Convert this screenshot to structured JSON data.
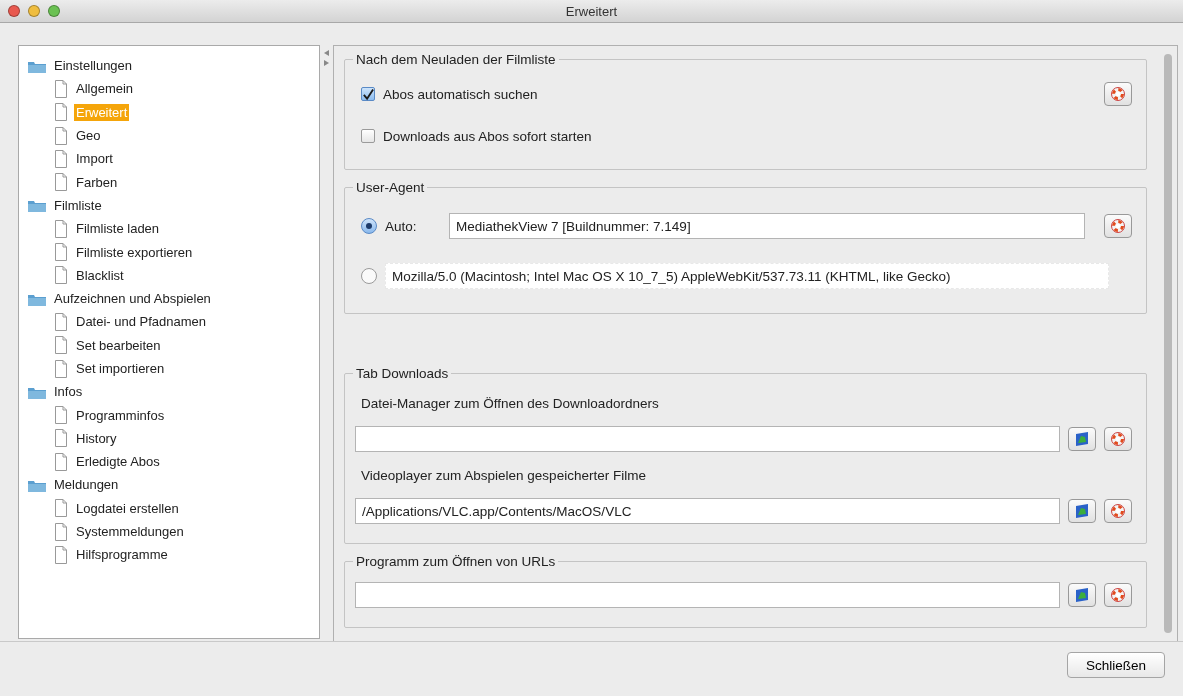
{
  "window": {
    "title": "Erweitert"
  },
  "tree": [
    {
      "label": "Einstellungen",
      "selected": false,
      "children": [
        {
          "label": "Allgemein",
          "selected": false
        },
        {
          "label": "Erweitert",
          "selected": true
        },
        {
          "label": "Geo",
          "selected": false
        },
        {
          "label": "Import",
          "selected": false
        },
        {
          "label": "Farben",
          "selected": false
        }
      ]
    },
    {
      "label": "Filmliste",
      "selected": false,
      "children": [
        {
          "label": "Filmliste laden",
          "selected": false
        },
        {
          "label": "Filmliste exportieren",
          "selected": false
        },
        {
          "label": "Blacklist",
          "selected": false
        }
      ]
    },
    {
      "label": "Aufzeichnen und Abspielen",
      "selected": false,
      "children": [
        {
          "label": "Datei- und Pfadnamen",
          "selected": false
        },
        {
          "label": "Set bearbeiten",
          "selected": false
        },
        {
          "label": "Set importieren",
          "selected": false
        }
      ]
    },
    {
      "label": "Infos",
      "selected": false,
      "children": [
        {
          "label": "Programminfos",
          "selected": false
        },
        {
          "label": "History",
          "selected": false
        },
        {
          "label": "Erledigte Abos",
          "selected": false
        }
      ]
    },
    {
      "label": "Meldungen",
      "selected": false,
      "children": [
        {
          "label": "Logdatei erstellen",
          "selected": false
        },
        {
          "label": "Systemmeldungen",
          "selected": false
        },
        {
          "label": "Hilfsprogramme",
          "selected": false
        }
      ]
    }
  ],
  "groups": [
    {
      "title": "Nach dem Neuladen der Filmliste",
      "rows": [
        {
          "kind": "checkbox",
          "label": "Abos automatisch suchen",
          "checked": true,
          "actions": [
            {
              "kind": "reset"
            }
          ]
        },
        {
          "kind": "checkbox",
          "label": "Downloads aus Abos sofort starten",
          "checked": false
        }
      ]
    },
    {
      "title": "User-Agent",
      "rows": [
        {
          "kind": "radio",
          "label": "Auto:",
          "selected": true,
          "value": "MediathekView 7  [Buildnummer: 7.149]",
          "actions": [
            {
              "kind": "reset"
            }
          ]
        },
        {
          "kind": "radio",
          "selected": false,
          "value": "Mozilla/5.0 (Macintosh; Intel Mac OS X 10_7_5) AppleWebKit/537.73.11 (KHTML, like Gecko)"
        }
      ]
    },
    {
      "title": "Tab Downloads",
      "rows": [
        {
          "kind": "label",
          "label": "Datei-Manager zum Öffnen des Downloadordners"
        },
        {
          "kind": "field",
          "actions": [
            {
              "kind": "browse"
            },
            {
              "kind": "reset"
            }
          ]
        },
        {
          "kind": "label",
          "label": "Videoplayer zum Abspielen gespeicherter Filme"
        },
        {
          "kind": "field",
          "value": "/Applications/VLC.app/Contents/MacOS/VLC",
          "actions": [
            {
              "kind": "browse"
            },
            {
              "kind": "reset"
            }
          ]
        }
      ]
    },
    {
      "title": "Programm zum Öffnen von URLs",
      "rows": [
        {
          "kind": "field",
          "actions": [
            {
              "kind": "browse"
            },
            {
              "kind": "reset"
            }
          ]
        }
      ]
    }
  ],
  "footer": {
    "close_button": "Schließen"
  }
}
